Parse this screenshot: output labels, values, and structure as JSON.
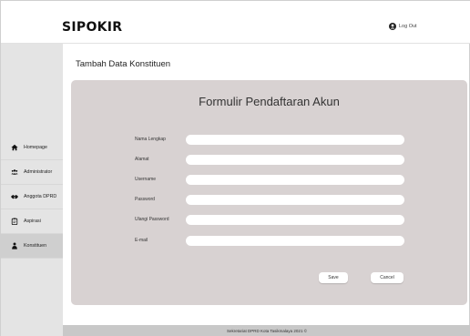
{
  "header": {
    "brand": "SIPOKIR",
    "logout_label": "Log Out"
  },
  "page": {
    "title": "Tambah Data Konstituen"
  },
  "sidebar": {
    "items": [
      {
        "label": "Homepage",
        "icon": "home-icon"
      },
      {
        "label": "Administrator",
        "icon": "users-icon"
      },
      {
        "label": "Anggota DPRD",
        "icon": "handshake-icon"
      },
      {
        "label": "Aspirasi",
        "icon": "clipboard-icon"
      },
      {
        "label": "Konstituen",
        "icon": "person-icon",
        "active": true
      }
    ]
  },
  "form": {
    "title": "Formulir Pendaftaran Akun",
    "fields": [
      {
        "label": "Nama Lengkap",
        "value": ""
      },
      {
        "label": "Alamat",
        "value": ""
      },
      {
        "label": "Username",
        "value": ""
      },
      {
        "label": "Password",
        "value": ""
      },
      {
        "label": "Ulangi Password",
        "value": ""
      },
      {
        "label": "E-mail",
        "value": ""
      }
    ],
    "save_label": "Save",
    "cancel_label": "Cancel"
  },
  "footer": {
    "text": "Sekretariat DPRD Kota Tasikmalaya 2021 ©"
  },
  "colors": {
    "card_bg": "#d8d2d2",
    "sidebar_bg": "#e4e4e4",
    "footer_bg": "#c8c8c8"
  }
}
